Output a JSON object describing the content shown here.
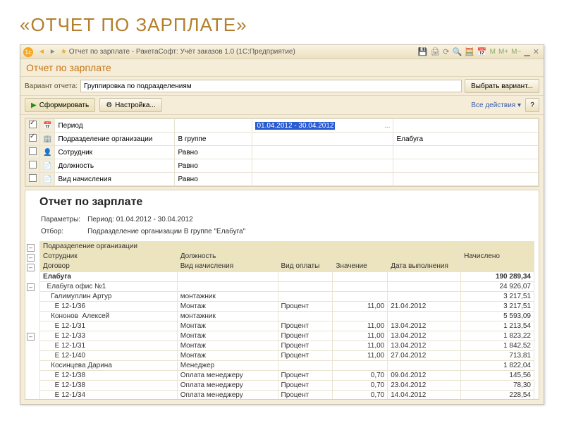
{
  "slide": {
    "title": "«ОТЧЕТ ПО ЗАРПЛАТЕ»"
  },
  "titlebar": {
    "text": "Отчет по зарплате - РакетаСофт: Учёт заказов 1.0  (1С:Предприятие)"
  },
  "m_buttons": {
    "m": "M",
    "mplus": "M+",
    "mminus": "M−"
  },
  "subheader": "Отчет по зарплате",
  "variant": {
    "label": "Вариант отчета:",
    "value": "Группировка по подразделениям",
    "select_btn": "Выбрать вариант..."
  },
  "toolbar2": {
    "form": "Сформировать",
    "settings": "Настройка...",
    "all_actions": "Все действия ▾",
    "help": "?"
  },
  "filters": {
    "cols": {
      "c1": "",
      "c2": ""
    },
    "rows": [
      {
        "chk": true,
        "icon": "📅",
        "field": "Период",
        "cond": "",
        "val": "01.04.2012 - 30.04.2012",
        "val_sel": true,
        "extra": "...",
        "val2": ""
      },
      {
        "chk": true,
        "icon": "🏢",
        "field": "Подразделение организации",
        "cond": "В группе",
        "val": "",
        "val2": "Елабуга"
      },
      {
        "chk": false,
        "icon": "👤",
        "field": "Сотрудник",
        "cond": "Равно",
        "val": "",
        "val2": ""
      },
      {
        "chk": false,
        "icon": "📄",
        "field": "Должность",
        "cond": "Равно",
        "val": "",
        "val2": ""
      },
      {
        "chk": false,
        "icon": "📄",
        "field": "Вид начисления",
        "cond": "Равно",
        "val": "",
        "val2": ""
      }
    ]
  },
  "report": {
    "title": "Отчет по зарплате",
    "params_label": "Параметры:",
    "params_value": "Период: 01.04.2012 - 30.04.2012",
    "filter_label": "Отбор:",
    "filter_value": "Подразделение организации В группе \"Елабуга\"",
    "head": {
      "division": "Подразделение организации",
      "employee": "Сотрудник",
      "position": "Должность",
      "contract": "Договор",
      "accrual_type": "Вид начисления",
      "pay_type": "Вид оплаты",
      "value": "Значение",
      "date": "Дата выполнения",
      "accrued": "Начислено"
    },
    "rows": [
      {
        "c1": "Елабуга",
        "c2": "",
        "c3": "",
        "c4": "",
        "c5": "",
        "accrued": "190 289,34",
        "bold": true
      },
      {
        "c1": "  Елабуга офис №1",
        "c2": "",
        "c3": "",
        "c4": "",
        "c5": "",
        "accrued": "24 926,07"
      },
      {
        "c1": "    Галимуллин Артур",
        "c2": "монтажник",
        "c3": "",
        "c4": "",
        "c5": "",
        "accrued": "3 217,51"
      },
      {
        "c1": "      Е 12-1/36",
        "c2": "Монтаж",
        "c3": "Процент",
        "c4": "11,00",
        "c5": "21.04.2012",
        "accrued": "3 217,51"
      },
      {
        "c1": "    Кононов  Алексей",
        "c2": "монтажник",
        "c3": "",
        "c4": "",
        "c5": "",
        "accrued": "5 593,09"
      },
      {
        "c1": "      Е 12-1/31",
        "c2": "Монтаж",
        "c3": "Процент",
        "c4": "11,00",
        "c5": "13.04.2012",
        "accrued": "1 213,54"
      },
      {
        "c1": "      Е 12-1/33",
        "c2": "Монтаж",
        "c3": "Процент",
        "c4": "11,00",
        "c5": "13.04.2012",
        "accrued": "1 823,22"
      },
      {
        "c1": "      Е 12-1/31",
        "c2": "Монтаж",
        "c3": "Процент",
        "c4": "11,00",
        "c5": "13.04.2012",
        "accrued": "1 842,52"
      },
      {
        "c1": "      Е 12-1/40",
        "c2": "Монтаж",
        "c3": "Процент",
        "c4": "11,00",
        "c5": "27.04.2012",
        "accrued": "713,81"
      },
      {
        "c1": "    Косинцева Дарина",
        "c2": "Менеджер",
        "c3": "",
        "c4": "",
        "c5": "",
        "accrued": "1 822,04"
      },
      {
        "c1": "      Е 12-1/38",
        "c2": "Оплата менеджеру",
        "c3": "Процент",
        "c4": "0,70",
        "c5": "09.04.2012",
        "accrued": "145,56"
      },
      {
        "c1": "      Е 12-1/38",
        "c2": "Оплата менеджеру",
        "c3": "Процент",
        "c4": "0,70",
        "c5": "23.04.2012",
        "accrued": "78,30"
      },
      {
        "c1": "      Е 12-1/34",
        "c2": "Оплата менеджеру",
        "c3": "Процент",
        "c4": "0,70",
        "c5": "14.04.2012",
        "accrued": "228,54"
      }
    ]
  }
}
